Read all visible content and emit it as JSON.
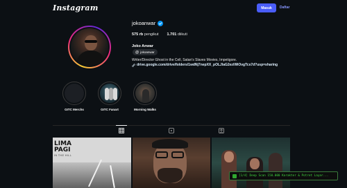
{
  "header": {
    "logo": "Instagram",
    "login_label": "Masuk",
    "signup_label": "Daftar"
  },
  "profile": {
    "username": "jokoanwar",
    "verified": true,
    "followers_count": "575 rb",
    "followers_label": "pengikut",
    "following_count": "1.701",
    "following_label": "diikuti",
    "full_name": "Joko Anwar",
    "threads_handle": "jokoanwar",
    "bio": "Writer/Director Ghost in the Cell, Satan's Slaves Movies, Impetigore.",
    "link": "drive.google.com/drive/folders/1wdNj7nepXX_pOLJlaG2eziWiOvgTcs7d?usp=sharing"
  },
  "highlights": [
    {
      "label": "GITC Merchs"
    },
    {
      "label": "GITC Fanart"
    },
    {
      "label": "Morning Walks"
    }
  ],
  "tabs": [
    {
      "icon": "grid-icon",
      "active": true
    },
    {
      "icon": "reels-icon",
      "active": false
    },
    {
      "icon": "tagged-icon",
      "active": false
    }
  ],
  "posts": [
    {
      "poster_title": "LIMA\nPAGI",
      "poster_sub": "IN THE HILL"
    },
    {},
    {}
  ],
  "overlay": {
    "text": "[1/4] Deep Scan 150.000 Karakter & Potret Layar..."
  },
  "colors": {
    "background": "#0c1014",
    "primary_button": "#4a5df9",
    "link": "#8796ff",
    "verified": "#0095f6",
    "toast_text": "#3fd63f"
  }
}
